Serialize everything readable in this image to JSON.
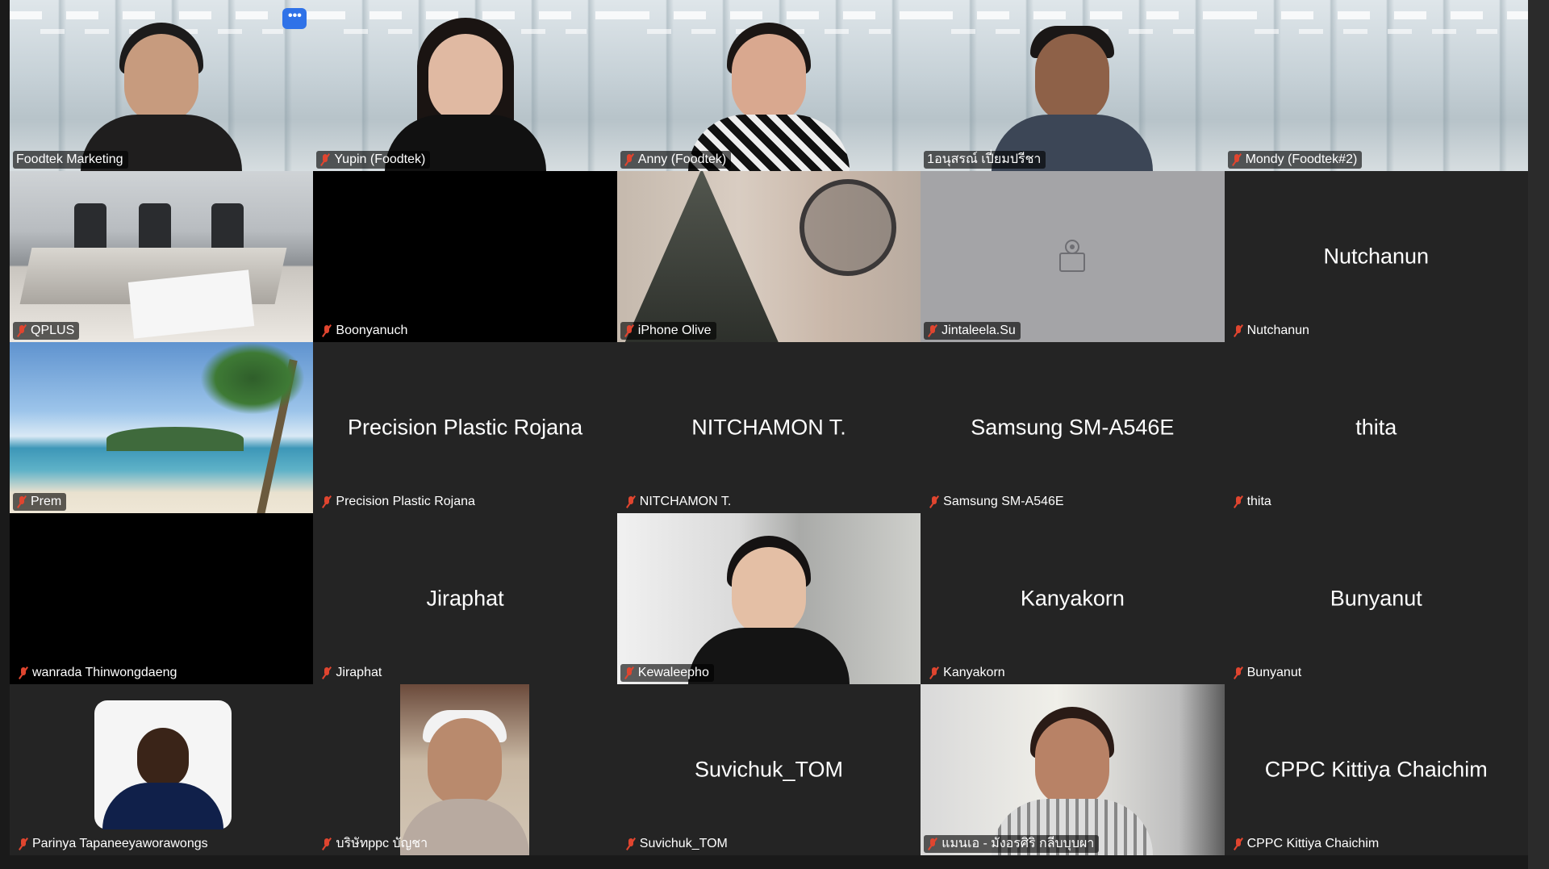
{
  "meeting": {
    "active_speaker": "Foodtek Marketing",
    "more_button_label": "•••"
  },
  "tiles": [
    {
      "name": "Foodtek Marketing",
      "muted": false,
      "video": true
    },
    {
      "name": "Yupin (Foodtek)",
      "muted": true,
      "video": true
    },
    {
      "name": "Anny (Foodtek)",
      "muted": true,
      "video": true
    },
    {
      "name": "1อนุสรณ์ เปี่ยมปรีชา",
      "muted": false,
      "video": true
    },
    {
      "name": "Mondy (Foodtek#2)",
      "muted": true,
      "video": true
    },
    {
      "name": "QPLUS",
      "muted": true,
      "video": true
    },
    {
      "name": "Boonyanuch",
      "muted": true,
      "video": false
    },
    {
      "name": "iPhone Olive",
      "muted": true,
      "video": true
    },
    {
      "name": "Jintaleela.Su",
      "muted": true,
      "video": false
    },
    {
      "name": "Nutchanun",
      "muted": true,
      "video": false,
      "display_name": "Nutchanun"
    },
    {
      "name": "Prem",
      "muted": true,
      "video": true
    },
    {
      "name": "Precision Plastic Rojana",
      "muted": true,
      "video": false,
      "display_name": "Precision Plastic Rojana"
    },
    {
      "name": "NITCHAMON T.",
      "muted": true,
      "video": false,
      "display_name": "NITCHAMON T."
    },
    {
      "name": "Samsung SM-A546E",
      "muted": true,
      "video": false,
      "display_name": "Samsung SM-A546E"
    },
    {
      "name": "thita",
      "muted": true,
      "video": false,
      "display_name": "thita"
    },
    {
      "name": "wanrada Thinwongdaeng",
      "muted": true,
      "video": false
    },
    {
      "name": "Jiraphat",
      "muted": true,
      "video": false,
      "display_name": "Jiraphat"
    },
    {
      "name": "Kewaleepho",
      "muted": true,
      "video": true
    },
    {
      "name": "Kanyakorn",
      "muted": true,
      "video": false,
      "display_name": "Kanyakorn"
    },
    {
      "name": "Bunyanut",
      "muted": true,
      "video": false,
      "display_name": "Bunyanut"
    },
    {
      "name": "Parinya Tapaneeyaworawongs",
      "muted": true,
      "video": true
    },
    {
      "name": "บริษัทppc บัญชา",
      "muted": true,
      "video": true
    },
    {
      "name": "Suvichuk_TOM",
      "muted": true,
      "video": false,
      "display_name": "Suvichuk_TOM"
    },
    {
      "name": "แมนเอ - มังอรศิริ กลีบบุบผา",
      "muted": true,
      "video": true
    },
    {
      "name": "CPPC Kittiya Chaichim",
      "muted": true,
      "video": false,
      "display_name": "CPPC Kittiya Chaichim"
    }
  ],
  "colors": {
    "background": "#1a1a1a",
    "tile_off": "#242424",
    "active_border": "#23d160",
    "mute_red": "#e0452f",
    "more_button": "#2f72e8"
  }
}
